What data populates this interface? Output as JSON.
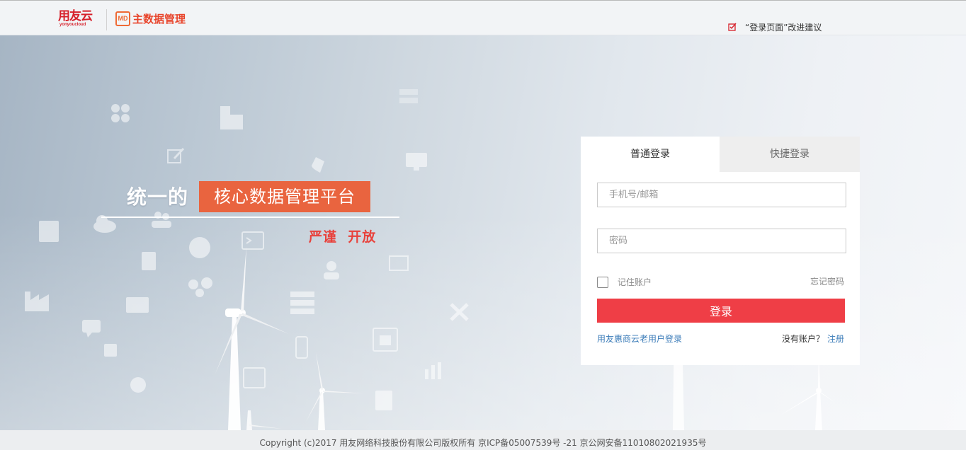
{
  "header": {
    "brand_cn": "用友云",
    "brand_en": "yonyoucloud",
    "product_badge": "MD",
    "product_name": "主数据管理",
    "feedback_text": "“登录页面”改进建议"
  },
  "hero": {
    "slogan_prefix": "统一的",
    "slogan_highlight": "核心数据管理平台",
    "slogan_sub": "严谨  开放"
  },
  "login": {
    "tabs": [
      {
        "label": "普通登录",
        "active": true
      },
      {
        "label": "快捷登录",
        "active": false
      }
    ],
    "phone_placeholder": "手机号/邮箱",
    "phone_value": "",
    "password_placeholder": "密码",
    "password_value": "",
    "remember_label": "记住账户",
    "remember_checked": false,
    "forgot_label": "忘记密码",
    "submit_label": "登录",
    "old_user_link": "用友惠商云老用户登录",
    "no_account_text": "没有账户？",
    "register_link": "注册"
  },
  "footer": {
    "copyright": "Copyright (c)2017 用友网络科技股份有限公司版权所有 京ICP备05007539号 -21 京公网安备11010802021935号"
  },
  "colors": {
    "accent_red": "#ef3e46",
    "slogan_orange": "#e9643f",
    "link_blue": "#3a7bb8",
    "brand_red": "#d6202a"
  },
  "icons": [
    "edit-checkbox-icon",
    "windmill-graphic",
    "clover-icon",
    "building-icon",
    "edit-icon",
    "rocket-icon",
    "monitor-icon",
    "cloud-icon",
    "users-icon",
    "terminal-icon",
    "globe-icon",
    "notebook-icon",
    "factory-icon",
    "gears-icon",
    "id-card-icon",
    "chat-icon",
    "tools-icon",
    "chart-icon",
    "mobile-icon",
    "package-icon"
  ]
}
